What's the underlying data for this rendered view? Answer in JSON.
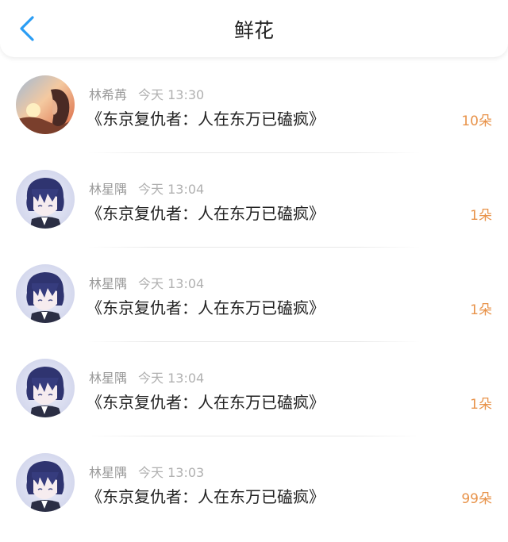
{
  "header": {
    "title": "鲜花",
    "back_icon": "chevron-left-icon",
    "accent_color": "#2a9df4"
  },
  "count_color": "#e8934a",
  "records": [
    {
      "user": "林希苒",
      "time": "今天 13:30",
      "book": "《东京复仇者：人在东万已磕疯》",
      "count": "10朵",
      "avatar": "avatar-sunset"
    },
    {
      "user": "林星隅",
      "time": "今天 13:04",
      "book": "《东京复仇者：人在东万已磕疯》",
      "count": "1朵",
      "avatar": "avatar-anime-boy"
    },
    {
      "user": "林星隅",
      "time": "今天 13:04",
      "book": "《东京复仇者：人在东万已磕疯》",
      "count": "1朵",
      "avatar": "avatar-anime-boy"
    },
    {
      "user": "林星隅",
      "time": "今天 13:04",
      "book": "《东京复仇者：人在东万已磕疯》",
      "count": "1朵",
      "avatar": "avatar-anime-boy"
    },
    {
      "user": "林星隅",
      "time": "今天 13:03",
      "book": "《东京复仇者：人在东万已磕疯》",
      "count": "99朵",
      "avatar": "avatar-anime-boy"
    }
  ]
}
